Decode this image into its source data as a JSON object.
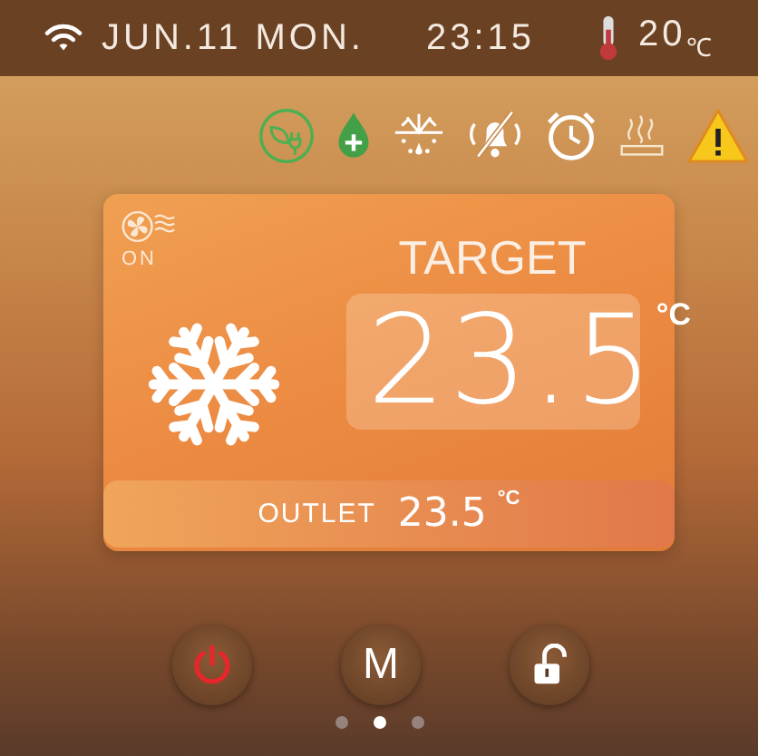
{
  "status_bar": {
    "date": "JUN.11 MON.",
    "time": "23:15",
    "temperature": "20",
    "unit": "℃"
  },
  "card": {
    "fan_status": "ON",
    "target_label": "TARGET",
    "target_value": "23.5",
    "target_unit": "°C",
    "outlet_label": "OUTLET",
    "outlet_value": "23.5",
    "outlet_unit": "°C"
  },
  "buttons": [
    {
      "kind": "power"
    },
    {
      "kind": "mode",
      "label": "M"
    },
    {
      "kind": "lock"
    }
  ],
  "page_dots": [
    {
      "selected": false
    },
    {
      "selected": true
    },
    {
      "selected": false
    }
  ]
}
